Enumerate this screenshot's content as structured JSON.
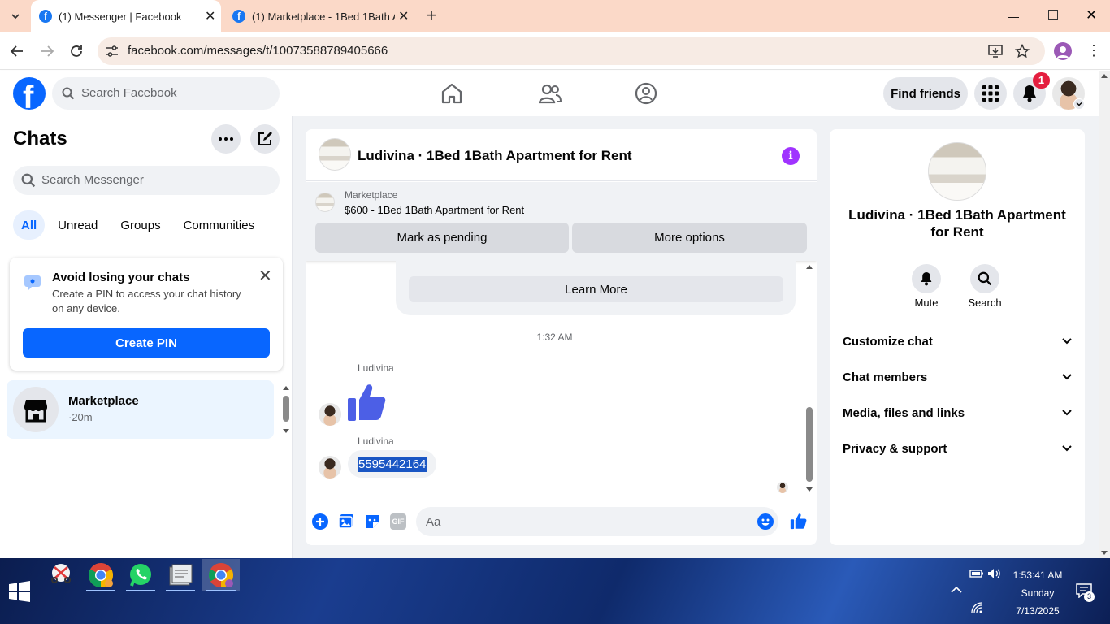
{
  "browser": {
    "tabs": [
      {
        "title": "(1) Messenger | Facebook"
      },
      {
        "title": "(1) Marketplace - 1Bed 1Bath Ap"
      }
    ],
    "url": "facebook.com/messages/t/10073588789405666"
  },
  "fb_header": {
    "search_placeholder": "Search Facebook",
    "find_friends": "Find friends",
    "notification_count": "1"
  },
  "chats": {
    "title": "Chats",
    "search_placeholder": "Search Messenger",
    "filters": [
      "All",
      "Unread",
      "Groups",
      "Communities"
    ],
    "pin_banner": {
      "title": "Avoid losing your chats",
      "body": "Create a PIN to access your chat history on any device.",
      "button": "Create PIN"
    },
    "list": [
      {
        "name": "Marketplace",
        "meta": "·20m"
      }
    ]
  },
  "conversation": {
    "title": "Ludivina · 1Bed 1Bath Apartment for Rent",
    "marketplace_label": "Marketplace",
    "listing": "$600 - 1Bed 1Bath Apartment for Rent",
    "mark_pending": "Mark as pending",
    "more_options": "More options",
    "learn_more": "Learn More",
    "timestamp": "1:32 AM",
    "messages": [
      {
        "sender": "Ludivina",
        "type": "like"
      },
      {
        "sender": "Ludivina",
        "text": "5595442164"
      }
    ],
    "composer_placeholder": "Aa"
  },
  "details": {
    "name": "Ludivina · 1Bed 1Bath Apartment for Rent",
    "actions": [
      {
        "label": "Mute",
        "icon": "bell-icon"
      },
      {
        "label": "Search",
        "icon": "search-icon"
      }
    ],
    "sections": [
      "Customize chat",
      "Chat members",
      "Media, files and links",
      "Privacy & support"
    ]
  },
  "taskbar": {
    "time": "1:53:41 AM",
    "day": "Sunday",
    "date": "7/13/2025",
    "notification_count": "3"
  },
  "colors": {
    "facebook_blue": "#0866ff",
    "messenger_purple": "#a033ff",
    "tab_bar": "#fbd9c8"
  }
}
